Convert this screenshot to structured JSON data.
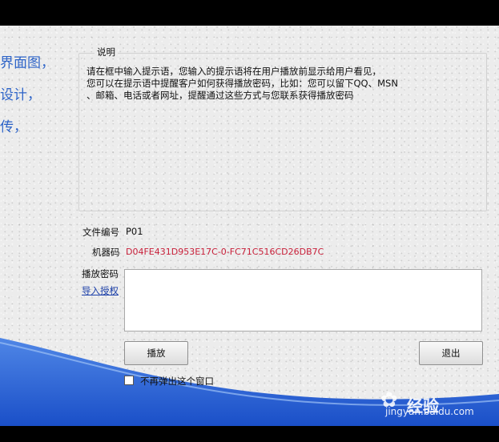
{
  "left_text": [
    "界面图，",
    "设计，",
    "传，"
  ],
  "group": {
    "title": "说明",
    "description_lines": [
      "请在框中输入提示语，您输入的提示语将在用户播放前显示给用户看见，",
      "您可以在提示语中提醒客户如何获得播放密码，比如：您可以留下QQ、MSN",
      "、邮箱、电话或者网址，提醒通过这些方式与您联系获得播放密码"
    ]
  },
  "fields": {
    "file_no_label": "文件编号",
    "file_no_value": "P01",
    "machine_code_label": "机器码",
    "machine_code_value": "D04FE431D953E17C-0-FC71C516CD26DB7C",
    "password_label": "播放密码",
    "import_link": "导入授权"
  },
  "buttons": {
    "play": "播放",
    "exit": "退出"
  },
  "checkbox": {
    "label": "不再弹出这个窗口",
    "checked": false
  },
  "watermark": {
    "brand": "Bai",
    "text": "经验",
    "url": "jingyan.baidu.com"
  },
  "colors": {
    "accent_blue": "#2e64c8",
    "machine_code": "#c8203a",
    "link": "#1a3ea8",
    "wave_blue": "#1f55cf"
  }
}
